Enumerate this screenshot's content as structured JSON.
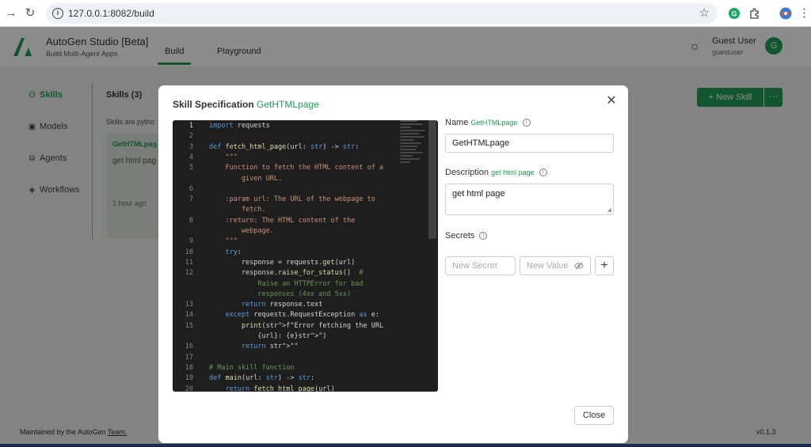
{
  "browser": {
    "url": "127.0.0.1:8082/build",
    "icons": [
      "forward-arrow-icon",
      "reload-icon",
      "site-info-icon",
      "bookmark-star-icon",
      "grammarly-extension-icon",
      "extensions-icon",
      "profile-icon",
      "menu-icon"
    ]
  },
  "header": {
    "title": "AutoGen Studio [Beta]",
    "subtitle": "Build Multi-Agent Apps",
    "tabs": [
      {
        "label": "Build"
      },
      {
        "label": "Playground"
      }
    ],
    "user_name": "Guest User",
    "user_handle": "guestuser",
    "avatar_letter": "G"
  },
  "sidebar": {
    "items": [
      {
        "label": "Skills"
      },
      {
        "label": "Models"
      },
      {
        "label": "Agents"
      },
      {
        "label": "Workflows"
      }
    ]
  },
  "skills_panel": {
    "heading": "Skills (3)",
    "description": "Skills are pytho",
    "new_skill_label": "New Skill",
    "more_label": "···",
    "card": {
      "title": "GetHTMLpag",
      "description": "get html pag",
      "time": "1 hour ago"
    }
  },
  "footer": {
    "prefix": "Maintained by the AutoGen ",
    "link": "Team.",
    "version": "v0.1.3"
  },
  "modal": {
    "title": "Skill Specification",
    "title_accent": "GetHTMLpage",
    "close_glyph": "✕",
    "name_label": "Name",
    "name_accent": "GetHTMLpage",
    "name_value": "GetHTMLpage",
    "description_label": "Description",
    "description_accent": "get html page",
    "description_value": "get html page",
    "secrets_label": "Secrets",
    "secret_placeholder": "New Secret",
    "value_placeholder": "New Value",
    "add_glyph": "+",
    "close_button": "Close"
  },
  "code": {
    "lines": [
      {
        "n": "1",
        "text": "import requests"
      },
      {
        "n": "2",
        "text": ""
      },
      {
        "n": "3",
        "text": "def fetch_html_page(url: str) -> str:"
      },
      {
        "n": "4",
        "text": "    \"\"\""
      },
      {
        "n": "5",
        "text": "    Function to fetch the HTML content of a"
      },
      {
        "n": "",
        "text": "        given URL."
      },
      {
        "n": "6",
        "text": ""
      },
      {
        "n": "7",
        "text": "    :param url: The URL of the webpage to"
      },
      {
        "n": "",
        "text": "        fetch."
      },
      {
        "n": "8",
        "text": "    :return: The HTML content of the"
      },
      {
        "n": "",
        "text": "        webpage."
      },
      {
        "n": "9",
        "text": "    \"\"\""
      },
      {
        "n": "10",
        "text": "    try:"
      },
      {
        "n": "11",
        "text": "        response = requests.get(url)"
      },
      {
        "n": "12",
        "text": "        response.raise_for_status()  #"
      },
      {
        "n": "",
        "text": "            Raise an HTTPError for bad"
      },
      {
        "n": "",
        "text": "            responses (4xx and 5xx)"
      },
      {
        "n": "13",
        "text": "        return response.text"
      },
      {
        "n": "14",
        "text": "    except requests.RequestException as e:"
      },
      {
        "n": "15",
        "text": "        print(f\"Error fetching the URL"
      },
      {
        "n": "",
        "text": "            {url}: {e}\")"
      },
      {
        "n": "16",
        "text": "        return \"\""
      },
      {
        "n": "17",
        "text": ""
      },
      {
        "n": "18",
        "text": "# Main skill function"
      },
      {
        "n": "19",
        "text": "def main(url: str) -> str:"
      },
      {
        "n": "20",
        "text": "    return fetch_html_page(url)"
      }
    ]
  }
}
